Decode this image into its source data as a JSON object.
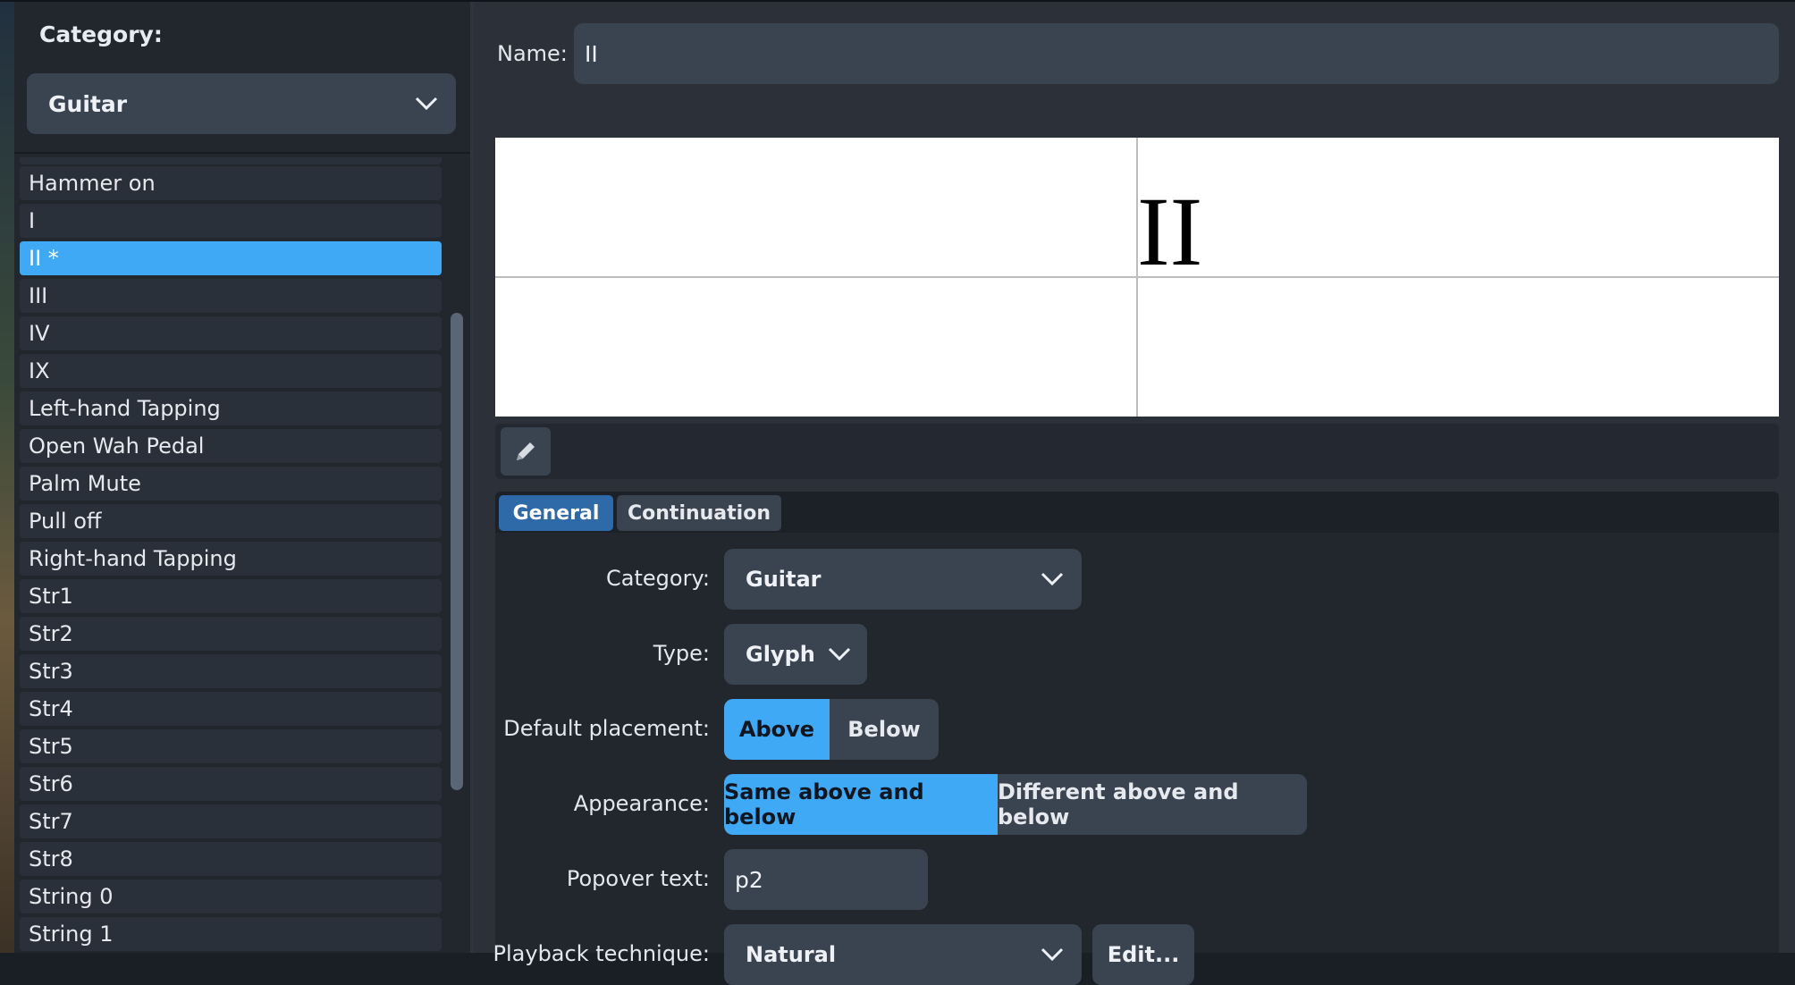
{
  "left": {
    "category_label": "Category:",
    "category_value": "Guitar",
    "items": [
      {
        "label": "Hammer on"
      },
      {
        "label": "I"
      },
      {
        "label": "II *",
        "selected": true
      },
      {
        "label": "III"
      },
      {
        "label": "IV"
      },
      {
        "label": "IX"
      },
      {
        "label": "Left-hand Tapping"
      },
      {
        "label": "Open Wah Pedal"
      },
      {
        "label": "Palm Mute"
      },
      {
        "label": "Pull off"
      },
      {
        "label": "Right-hand Tapping"
      },
      {
        "label": "Str1"
      },
      {
        "label": "Str2"
      },
      {
        "label": "Str3"
      },
      {
        "label": "Str4"
      },
      {
        "label": "Str5"
      },
      {
        "label": "Str6"
      },
      {
        "label": "Str7"
      },
      {
        "label": "Str8"
      },
      {
        "label": "String 0"
      },
      {
        "label": "String 1"
      }
    ]
  },
  "right": {
    "name_label": "Name:",
    "name_value": "II",
    "preview_glyph": "II",
    "tabs": [
      {
        "label": "General",
        "active": true
      },
      {
        "label": "Continuation",
        "active": false
      }
    ],
    "form": {
      "category_label": "Category:",
      "category_value": "Guitar",
      "type_label": "Type:",
      "type_value": "Glyph",
      "placement_label": "Default placement:",
      "placement_above": "Above",
      "placement_below": "Below",
      "appearance_label": "Appearance:",
      "appearance_same": "Same above and below",
      "appearance_different": "Different above and below",
      "popover_label": "Popover text:",
      "popover_value": "p2",
      "playback_label": "Playback technique:",
      "playback_value": "Natural",
      "edit_label": "Edit..."
    }
  },
  "colors": {
    "accent": "#3fa9f5",
    "tab_active": "#2f6aa8",
    "control_bg": "#3a4350",
    "panel_bg": "#2b3039"
  }
}
